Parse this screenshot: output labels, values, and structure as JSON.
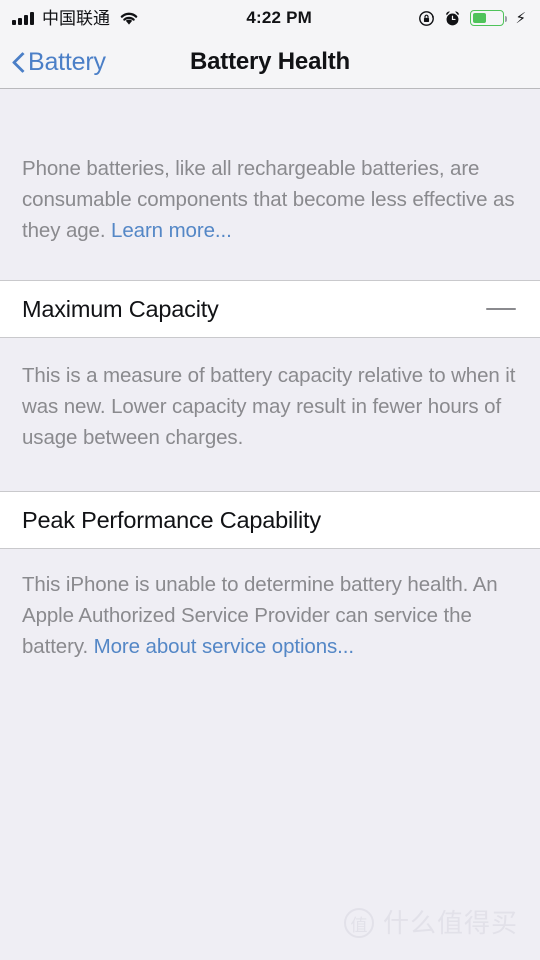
{
  "status_bar": {
    "signal_icon": "signal-bars-icon",
    "carrier": "中国联通",
    "wifi_icon": "wifi-icon",
    "time": "4:22 PM",
    "rotation_lock_icon": "rotation-lock-icon",
    "alarm_icon": "alarm-clock-icon",
    "battery_icon": "battery-icon",
    "battery_level_percent": 42,
    "battery_color": "#4FC35A",
    "charging_icon": "lightning-bolt-icon"
  },
  "nav_bar": {
    "back_icon": "chevron-left-icon",
    "back_label": "Battery",
    "title": "Battery Health",
    "tint_color": "#4B7FC7"
  },
  "content": {
    "intro_note": {
      "text": "Phone batteries, like all rechargeable batteries, are consumable components that become less effective as they age. ",
      "link_label": "Learn more..."
    },
    "maximum_capacity": {
      "title": "Maximum Capacity",
      "value": "—"
    },
    "capacity_note": "This is a measure of battery capacity relative to when it was new. Lower capacity may result in fewer hours of usage between charges.",
    "peak_performance": {
      "title": "Peak Performance Capability"
    },
    "performance_note": {
      "text": "This iPhone is unable to determine battery health. An Apple Authorized Service Provider can service the battery. ",
      "link_label": "More about service options..."
    },
    "link_color": "#5487C6"
  },
  "watermark": {
    "logo_glyph": "值",
    "text": "什么值得买"
  }
}
